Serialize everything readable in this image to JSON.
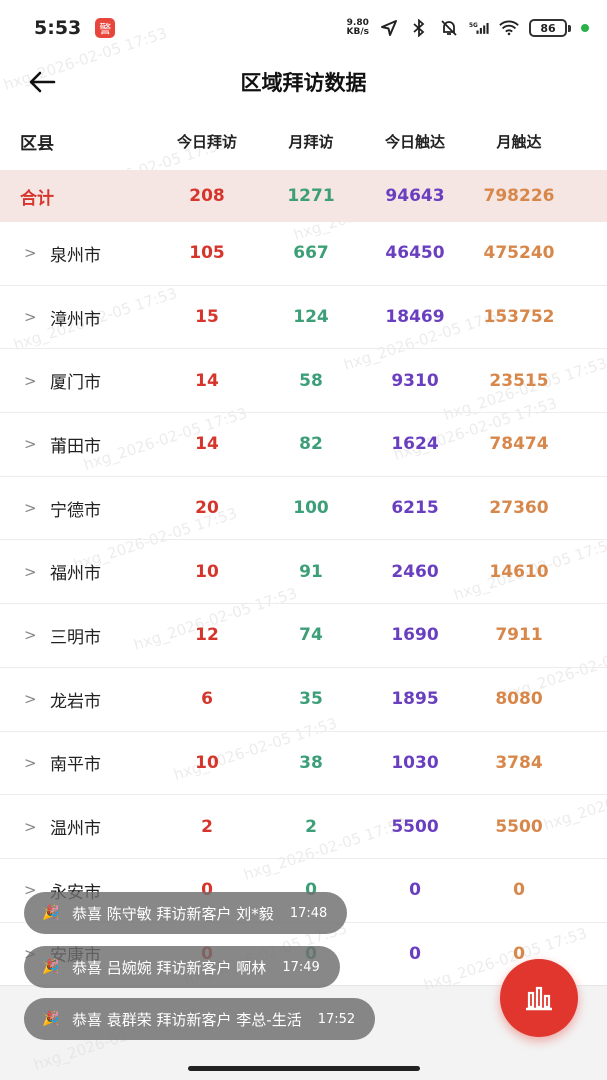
{
  "status_bar": {
    "time": "5:53",
    "app_icon_text": "警",
    "net_speed_value": "9.80",
    "net_speed_unit": "KB/s",
    "battery": "86"
  },
  "header": {
    "title": "区域拜访数据"
  },
  "table": {
    "columns": [
      "区县",
      "今日拜访",
      "月拜访",
      "今日触达",
      "月触达"
    ],
    "total": {
      "name": "合计",
      "today_visit": "208",
      "month_visit": "1271",
      "today_reach": "94643",
      "month_reach": "798226"
    },
    "rows": [
      {
        "name": "泉州市",
        "today_visit": "105",
        "month_visit": "667",
        "today_reach": "46450",
        "month_reach": "475240"
      },
      {
        "name": "漳州市",
        "today_visit": "15",
        "month_visit": "124",
        "today_reach": "18469",
        "month_reach": "153752"
      },
      {
        "name": "厦门市",
        "today_visit": "14",
        "month_visit": "58",
        "today_reach": "9310",
        "month_reach": "23515"
      },
      {
        "name": "莆田市",
        "today_visit": "14",
        "month_visit": "82",
        "today_reach": "1624",
        "month_reach": "78474"
      },
      {
        "name": "宁德市",
        "today_visit": "20",
        "month_visit": "100",
        "today_reach": "6215",
        "month_reach": "27360"
      },
      {
        "name": "福州市",
        "today_visit": "10",
        "month_visit": "91",
        "today_reach": "2460",
        "month_reach": "14610"
      },
      {
        "name": "三明市",
        "today_visit": "12",
        "month_visit": "74",
        "today_reach": "1690",
        "month_reach": "7911"
      },
      {
        "name": "龙岩市",
        "today_visit": "6",
        "month_visit": "35",
        "today_reach": "1895",
        "month_reach": "8080"
      },
      {
        "name": "南平市",
        "today_visit": "10",
        "month_visit": "38",
        "today_reach": "1030",
        "month_reach": "3784"
      },
      {
        "name": "温州市",
        "today_visit": "2",
        "month_visit": "2",
        "today_reach": "5500",
        "month_reach": "5500"
      },
      {
        "name": "永安市",
        "today_visit": "0",
        "month_visit": "0",
        "today_reach": "0",
        "month_reach": "0"
      },
      {
        "name": "安康市",
        "today_visit": "0",
        "month_visit": "0",
        "today_reach": "0",
        "month_reach": "0"
      }
    ]
  },
  "notifications": [
    {
      "text": "恭喜 陈守敏 拜访新客户 刘*毅",
      "time": "17:48"
    },
    {
      "text": "恭喜 吕婉婉 拜访新客户 啊林",
      "time": "17:49"
    },
    {
      "text": "恭喜 袁群荣 拜访新客户 李总-生活",
      "time": "17:52"
    }
  ],
  "watermark": "hxg_2026-02-05 17:53",
  "colors": {
    "accent": "#d6352c",
    "today_visit": "#d6352c",
    "month_visit": "#3d9f77",
    "today_reach": "#6a3fbf",
    "month_reach": "#d8874a",
    "total_row_bg": "#f5e6e4"
  },
  "icons": {
    "back": "back-arrow-icon",
    "row_expand": "chevron-right-icon",
    "fab": "bar-chart-icon",
    "toast": "party-popper-icon"
  }
}
